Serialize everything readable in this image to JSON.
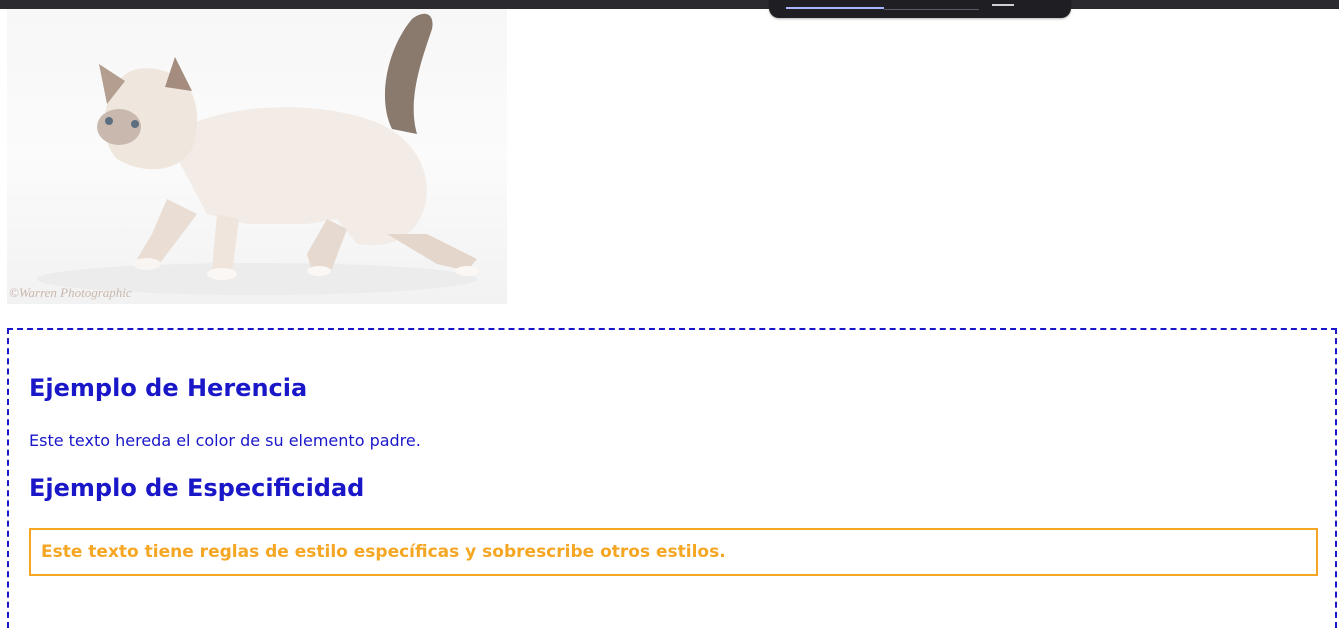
{
  "image": {
    "watermark": "©Warren Photographic",
    "description_icon": "kitten-photo"
  },
  "sections": {
    "inheritance": {
      "heading": "Ejemplo de Herencia",
      "paragraph": "Este texto hereda el color de su elemento padre."
    },
    "specificity": {
      "heading": "Ejemplo de Especificidad",
      "paragraph": "Este texto tiene reglas de estilo específicas y sobrescribe otros estilos."
    }
  },
  "colors": {
    "inherited_text": "#1a17c9",
    "specific_text": "#f5a623",
    "topbar": "#2b2b2f"
  }
}
